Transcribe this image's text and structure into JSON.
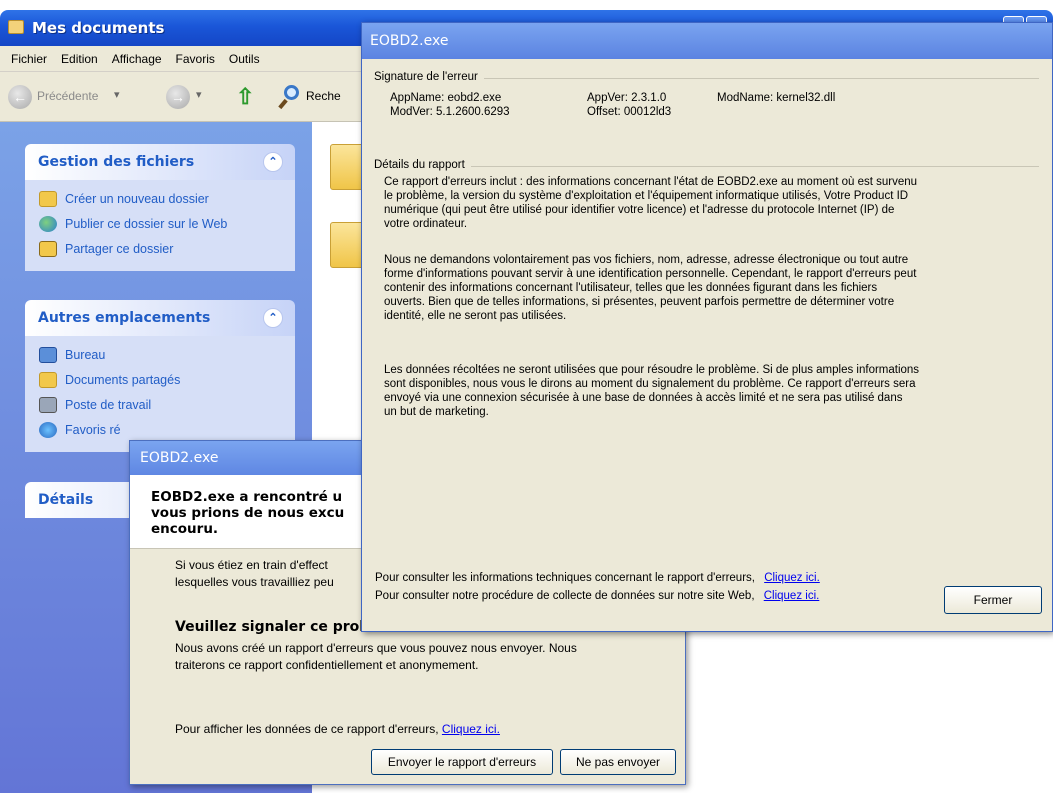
{
  "explorer": {
    "title": "Mes documents",
    "menu": [
      "Fichier",
      "Edition",
      "Affichage",
      "Favoris",
      "Outils"
    ],
    "toolbar": {
      "back_label": "Précédente",
      "search_label": "Reche"
    },
    "panels": {
      "file_tasks": {
        "title": "Gestion des fichiers",
        "items": [
          "Créer un nouveau dossier",
          "Publier ce dossier sur le Web",
          "Partager ce dossier"
        ]
      },
      "other_places": {
        "title": "Autres emplacements",
        "items": [
          "Bureau",
          "Documents partagés",
          "Poste de travail",
          "Favoris ré"
        ]
      },
      "details": {
        "title": "Détails"
      }
    }
  },
  "error_dialog": {
    "title": "EOBD2.exe",
    "heading_lines": [
      "EOBD2.exe a rencontré u",
      "vous prions de nous excu",
      "encouru."
    ],
    "body_lines": [
      "Si vous étiez en train d'effect",
      "lesquelles vous travailliez peu"
    ],
    "subheading": "Veuillez signaler ce prob",
    "report_lines": [
      "Nous avons créé un rapport d'erreurs que vous pouvez nous envoyer. Nous",
      "traiterons ce rapport confidentiellement et anonymement."
    ],
    "view_data_text": "Pour afficher les données de ce rapport d'erreurs,",
    "view_data_link": "Cliquez ici.",
    "send_button": "Envoyer le rapport d'erreurs",
    "dont_send_button": "Ne pas envoyer"
  },
  "report_dialog": {
    "title": "EOBD2.exe",
    "signature_label": "Signature de l'erreur",
    "signature": {
      "appname": "AppName: eobd2.exe",
      "appver": "AppVer: 2.3.1.0",
      "modname": "ModName: kernel32.dll",
      "modver": "ModVer: 5.1.2600.6293",
      "offset": "Offset: 00012ld3"
    },
    "details_label": "Détails du rapport",
    "paragraph1": [
      "Ce rapport d'erreurs inclut : des informations concernant l'état de EOBD2.exe au moment où est survenu",
      "le problème, la version du système d'exploitation et l'équipement informatique utilisés, Votre Product ID",
      "numérique (qui peut être utilisé pour identifier votre licence) et l'adresse du protocole Internet (IP) de",
      "votre ordinateur."
    ],
    "paragraph2": [
      "Nous ne demandons volontairement pas vos fichiers, nom, adresse, adresse électronique ou tout autre",
      "forme d'informations pouvant servir à une identification personnelle. Cependant, le rapport d'erreurs peut",
      "contenir des informations concernant l'utilisateur, telles que les données figurant dans les fichiers",
      "ouverts. Bien que de telles informations, si présentes, peuvent parfois permettre de déterminer votre",
      "identité, elle ne seront pas utilisées."
    ],
    "paragraph3": [
      "Les données récoltées ne seront utilisées que pour résoudre le problème. Si de plus amples informations",
      "sont disponibles, nous vous le dirons au moment du signalement du problème. Ce rapport d'erreurs sera",
      "envoyé via une connexion sécurisée à une base de données à accès limité et ne sera pas utilisé dans",
      "un but de marketing."
    ],
    "tech_info_text": "Pour consulter les informations techniques concernant le rapport d'erreurs,",
    "tech_info_link": "Cliquez ici.",
    "policy_text": "Pour consulter notre procédure de collecte de données sur notre site Web,",
    "policy_link": "Cliquez ici.",
    "close_button": "Fermer"
  }
}
